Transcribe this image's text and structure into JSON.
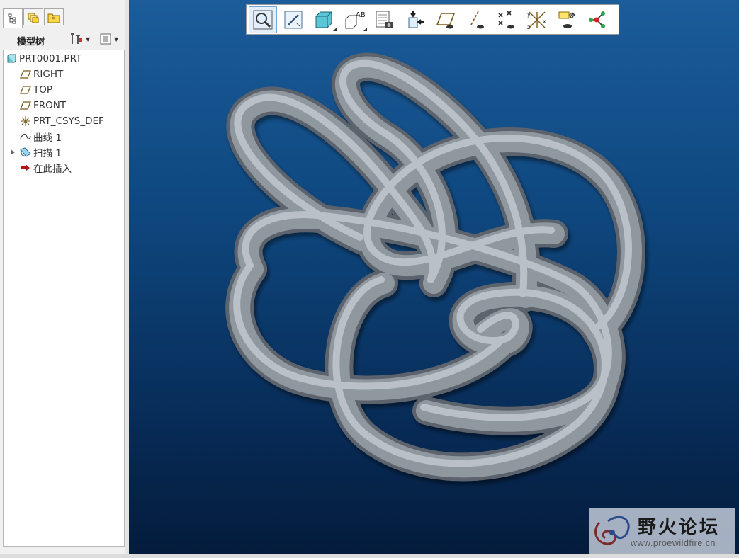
{
  "panel": {
    "title": "模型树",
    "tabs": [
      "model-tree-tab-icon",
      "layers-tab-icon",
      "favorites-tab-icon"
    ]
  },
  "tree": {
    "items": [
      {
        "label": "PRT0001.PRT",
        "icon": "part-icon"
      },
      {
        "label": "RIGHT",
        "icon": "datum-plane-icon"
      },
      {
        "label": "TOP",
        "icon": "datum-plane-icon"
      },
      {
        "label": "FRONT",
        "icon": "datum-plane-icon"
      },
      {
        "label": "PRT_CSYS_DEF",
        "icon": "coordinate-system-icon"
      },
      {
        "label": "曲线 1",
        "icon": "curve-icon"
      },
      {
        "label": "扫描 1",
        "icon": "sweep-icon"
      },
      {
        "label": "在此插入",
        "icon": "insert-here-arrow-icon"
      }
    ]
  },
  "toolbar": {
    "buttons": [
      "zoom-fit-icon",
      "repaint-icon",
      "display-style-icon",
      "saved-views-icon",
      "view-manager-icon",
      "orient-icon",
      "datum-plane-display-icon",
      "datum-axis-display-icon",
      "datum-point-display-icon",
      "coordinate-system-display-icon",
      "annotation-display-icon",
      "spin-center-icon"
    ]
  },
  "watermark": {
    "title": "野火论坛",
    "url": "www.proewildfire.cn"
  },
  "colors": {
    "viewport_top": "#1b5c9a",
    "viewport_bottom": "#041c3c",
    "model_surface": "#8e959d"
  }
}
